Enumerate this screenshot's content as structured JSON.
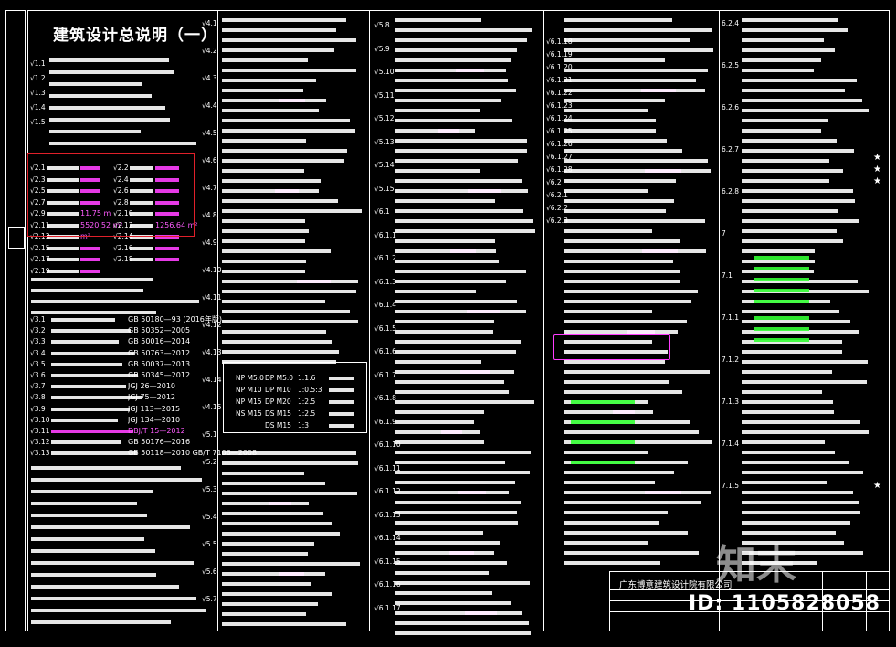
{
  "drawing": {
    "title": "建筑设计总说明（一）",
    "company": "广东博意建筑设计院有限公司",
    "watermark_logo": "知末",
    "watermark_id": "ID: 1105828058"
  },
  "col1_rows": [
    {
      "num": "1.1",
      "text": ""
    },
    {
      "num": "1.2",
      "text": ""
    },
    {
      "num": "1.3",
      "text": ""
    },
    {
      "num": "1.4",
      "text": ""
    },
    {
      "num": "1.5",
      "text": ""
    }
  ],
  "standards": [
    {
      "num": "3.1",
      "text": "",
      "code": "GB 50180—93 (2016年版)"
    },
    {
      "num": "3.2",
      "text": "",
      "code": "GB 50352—2005"
    },
    {
      "num": "3.3",
      "text": "",
      "code": "GB 50016—2014"
    },
    {
      "num": "3.4",
      "text": "",
      "code": "GB 50763—2012"
    },
    {
      "num": "3.5",
      "text": "",
      "code": "GB 50037—2013"
    },
    {
      "num": "3.6",
      "text": "",
      "code": "GB 50345—2012"
    },
    {
      "num": "3.7",
      "text": "",
      "code": "JGJ 26—2010"
    },
    {
      "num": "3.8",
      "text": "",
      "code": "JGJ 75—2012"
    },
    {
      "num": "3.9",
      "text": "",
      "code": "JGJ 113—2015"
    },
    {
      "num": "3.10",
      "text": "",
      "code": "JGJ 134—2010"
    },
    {
      "num": "3.11",
      "text": "",
      "code": "DBJ/T 15—2012"
    },
    {
      "num": "3.12",
      "text": "",
      "code": "GB 50176—2016"
    },
    {
      "num": "3.13",
      "text": "",
      "code": "GB 50118—2010  GB/T 7106—2008"
    }
  ],
  "project_info": [
    {
      "num": "2.1",
      "label": "",
      "value": ""
    },
    {
      "num": "2.3",
      "label": "",
      "value": ""
    },
    {
      "num": "2.5",
      "label": "",
      "value": ""
    },
    {
      "num": "2.7",
      "label": "",
      "value": ""
    },
    {
      "num": "2.9",
      "label": "",
      "value": "11.75 m"
    },
    {
      "num": "2.11",
      "label": "",
      "value": "5520.52 m²"
    },
    {
      "num": "2.13",
      "label": "",
      "value": "m²"
    },
    {
      "num": "2.15",
      "label": "",
      "value": ""
    },
    {
      "num": "2.17",
      "label": "",
      "value": ""
    },
    {
      "num": "2.19",
      "label": "",
      "value": ""
    }
  ],
  "project_info_right": [
    {
      "num": "2.2",
      "value": ""
    },
    {
      "num": "2.4",
      "value": ""
    },
    {
      "num": "2.6",
      "value": ""
    },
    {
      "num": "2.8",
      "value": ""
    },
    {
      "num": "2.10",
      "value": ""
    },
    {
      "num": "2.12",
      "value": "1256.64 m²"
    },
    {
      "num": "2.14",
      "value": ""
    },
    {
      "num": "2.16",
      "value": ""
    },
    {
      "num": "2.18",
      "value": ""
    }
  ],
  "col2_nums": [
    "4.1",
    "4.2",
    "4.3",
    "4.4",
    "4.5",
    "4.6",
    "4.7",
    "4.8",
    "4.9",
    "4.10",
    "4.11",
    "4.12",
    "4.13",
    "4.14",
    "4.15",
    "5.1",
    "5.2",
    "5.3",
    "5.4",
    "5.5",
    "5.6",
    "5.7"
  ],
  "mortar_table": {
    "header": [
      "",
      "",
      "",
      "",
      ""
    ],
    "rows": [
      [
        "NP M5.0",
        "DP M5.0",
        "1:1:6",
        ""
      ],
      [
        "NP M10",
        "DP M10",
        "1:0.5:3",
        ""
      ],
      [
        "NP M15",
        "DP M20",
        "1:2.5",
        ""
      ],
      [
        "NS M15",
        "DS M15",
        "1:2.5",
        ""
      ],
      [
        "",
        "DS M15",
        "1:3",
        ""
      ]
    ]
  },
  "col3_nums": [
    "5.8",
    "5.9",
    "5.10",
    "5.11",
    "5.12",
    "5.13",
    "5.14",
    "5.15",
    "6.1",
    "6.1.1",
    "6.1.2",
    "6.1.3",
    "6.1.4",
    "6.1.5",
    "6.1.6",
    "6.1.7",
    "6.1.8",
    "6.1.9",
    "6.1.10",
    "6.1.11",
    "6.1.12",
    "6.1.13",
    "6.1.14",
    "6.1.15",
    "6.1.16",
    "6.1.17"
  ],
  "col4_nums": [
    "6.1.18",
    "6.1.19",
    "6.1.20",
    "6.1.21",
    "6.1.22",
    "6.1.23",
    "6.1.24",
    "6.1.25",
    "6.1.26",
    "6.1.27",
    "6.1.28",
    "6.2",
    "6.2.1",
    "6.2.2",
    "6.2.3"
  ],
  "col5_nums": [
    "6.2.4",
    "6.2.5",
    "6.2.6",
    "6.2.7",
    "6.2.8",
    "7",
    "7.1",
    "7.1.1",
    "7.1.2",
    "7.1.3",
    "7.1.4",
    "7.1.5"
  ],
  "colors": {
    "background": "#000000",
    "line": "#ffffff",
    "highlight_magenta": "#ff5cff",
    "highlight_green": "#3cff3c",
    "red_box": "#e0202a"
  }
}
